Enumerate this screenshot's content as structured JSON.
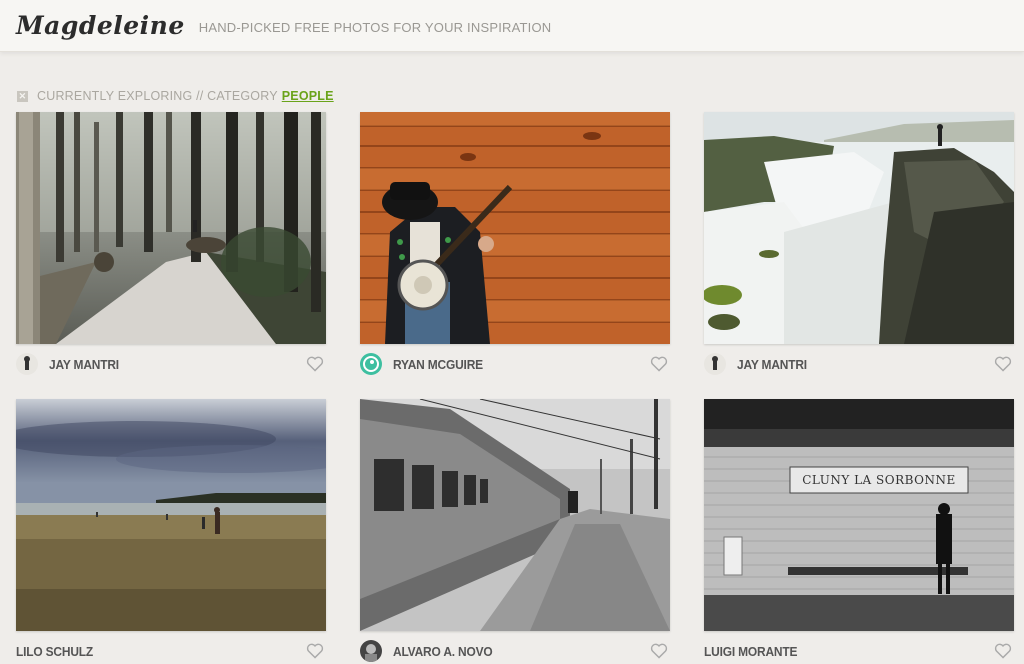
{
  "header": {
    "logo": "Magdeleine",
    "tagline": "HAND-PICKED FREE PHOTOS FOR YOUR INSPIRATION"
  },
  "filter": {
    "prefix": "CURRENTLY EXPLORING // CATEGORY",
    "category": "PEOPLE",
    "clear_icon": "close-icon"
  },
  "photos": [
    {
      "author": "JAY MANTRI",
      "subject": "forest-trail"
    },
    {
      "author": "RYAN MCGUIRE",
      "subject": "banjo-player"
    },
    {
      "author": "JAY MANTRI",
      "subject": "waterfall"
    },
    {
      "author": "LILO SCHULZ",
      "subject": "beach"
    },
    {
      "author": "ALVARO A. NOVO",
      "subject": "train-platform"
    },
    {
      "author": "LUIGI MORANTE",
      "subject": "metro-station"
    }
  ],
  "metro_sign": "CLUNY LA SORBONNE",
  "colors": {
    "accent": "#6aa31a",
    "background": "#efedea"
  }
}
